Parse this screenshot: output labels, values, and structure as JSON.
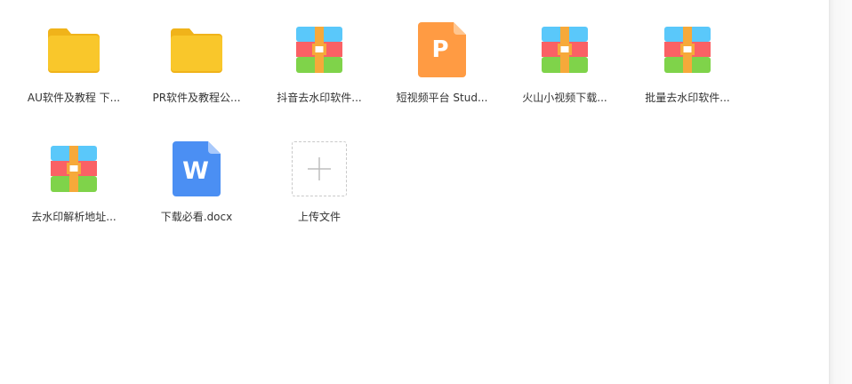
{
  "files": [
    {
      "name": "AU软件及教程 下...",
      "type": "folder"
    },
    {
      "name": "PR软件及教程公...",
      "type": "folder"
    },
    {
      "name": "抖音去水印软件...",
      "type": "archive"
    },
    {
      "name": "短视频平台 Stud...",
      "type": "ppt",
      "glyph": "P"
    },
    {
      "name": "火山小视频下载...",
      "type": "archive"
    },
    {
      "name": "批量去水印软件...",
      "type": "archive"
    },
    {
      "name": "去水印解析地址...",
      "type": "archive"
    },
    {
      "name": "下载必看.docx",
      "type": "word",
      "glyph": "W"
    }
  ],
  "upload": {
    "label": "上传文件"
  },
  "colors": {
    "folder": "#f9c72b",
    "folder_tab": "#f0b31a",
    "ppt": "#ff9b43",
    "word": "#4b8ff3",
    "archive_blue": "#5ac8fa",
    "archive_red": "#fa6165",
    "archive_green": "#7fd34a",
    "archive_orange": "#f6a93a"
  }
}
